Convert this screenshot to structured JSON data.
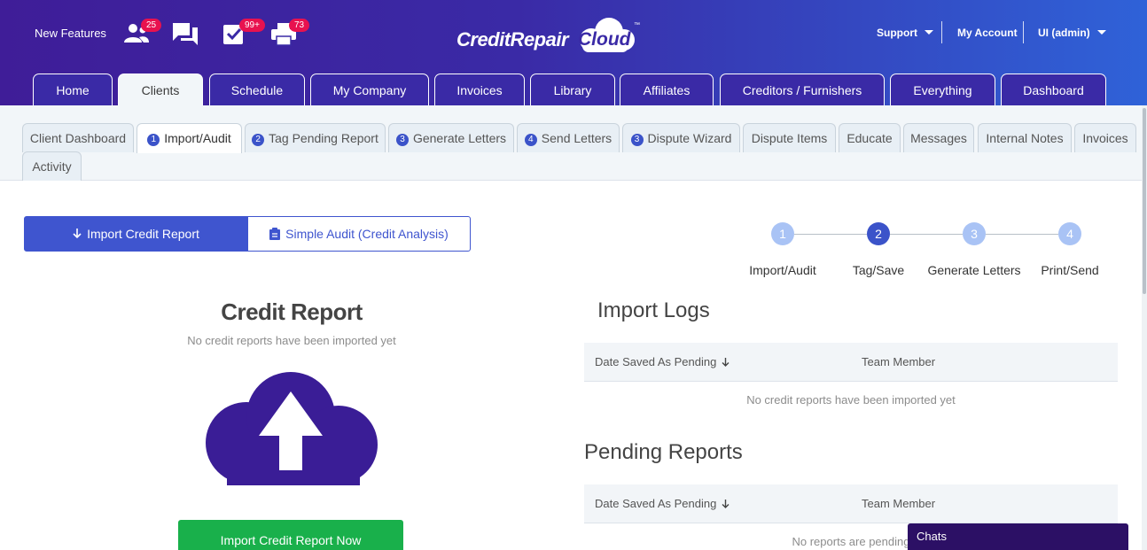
{
  "header": {
    "new_features": "New Features",
    "badges": {
      "clients": "25",
      "tasks": "99+",
      "print": "73"
    },
    "logo": {
      "text": "CreditRepair",
      "cloud": "Cloud",
      "tm": "™"
    },
    "support": "Support",
    "my_account": "My Account",
    "user": "UI (admin)",
    "icons": [
      "users-icon",
      "chat-icon",
      "checkbox-icon",
      "printer-icon"
    ]
  },
  "main_tabs": [
    {
      "label": "Home"
    },
    {
      "label": "Clients",
      "active": true
    },
    {
      "label": "Schedule"
    },
    {
      "label": "My Company"
    },
    {
      "label": "Invoices"
    },
    {
      "label": "Library"
    },
    {
      "label": "Affiliates"
    },
    {
      "label": "Creditors / Furnishers"
    },
    {
      "label": "Everything"
    },
    {
      "label": "Dashboard"
    }
  ],
  "sub_tabs": [
    {
      "label": "Client Dashboard",
      "num": ""
    },
    {
      "label": "Import/Audit",
      "num": "1",
      "active": true
    },
    {
      "label": "Tag Pending Report",
      "num": "2"
    },
    {
      "label": "Generate Letters",
      "num": "3"
    },
    {
      "label": "Send Letters",
      "num": "4"
    },
    {
      "label": "Dispute Wizard",
      "num": "3"
    },
    {
      "label": "Dispute Items",
      "num": ""
    },
    {
      "label": "Educate",
      "num": ""
    },
    {
      "label": "Messages",
      "num": ""
    },
    {
      "label": "Internal Notes",
      "num": ""
    },
    {
      "label": "Invoices",
      "num": ""
    },
    {
      "label": "Activity",
      "num": ""
    }
  ],
  "toggle": {
    "import_label": "Import Credit Report",
    "audit_label": "Simple Audit (Credit Analysis)"
  },
  "stepper": [
    {
      "num": "1",
      "label": "Import/Audit",
      "active": false
    },
    {
      "num": "2",
      "label": "Tag/Save",
      "active": true
    },
    {
      "num": "3",
      "label": "Generate Letters",
      "active": false
    },
    {
      "num": "4",
      "label": "Print/Send",
      "active": false
    }
  ],
  "credit_report": {
    "title": "Credit Report",
    "subtitle": "No credit reports have been imported yet",
    "button": "Import Credit Report Now"
  },
  "import_logs": {
    "title": "Import Logs",
    "col1": "Date Saved As Pending",
    "col2": "Team Member",
    "empty": "No credit reports have been imported yet"
  },
  "pending_reports": {
    "title": "Pending Reports",
    "col1": "Date Saved As Pending",
    "col2": "Team Member",
    "empty": "No reports are pending"
  },
  "chats": "Chats",
  "colors": {
    "header_start": "#3f1d98",
    "header_end": "#2f62d8",
    "primary": "#3f55cf",
    "badge": "#e8124f",
    "success": "#19b04b",
    "cloud": "#3a1d96",
    "step_inactive": "#a9c3f5",
    "step_active": "#3b53c9"
  }
}
